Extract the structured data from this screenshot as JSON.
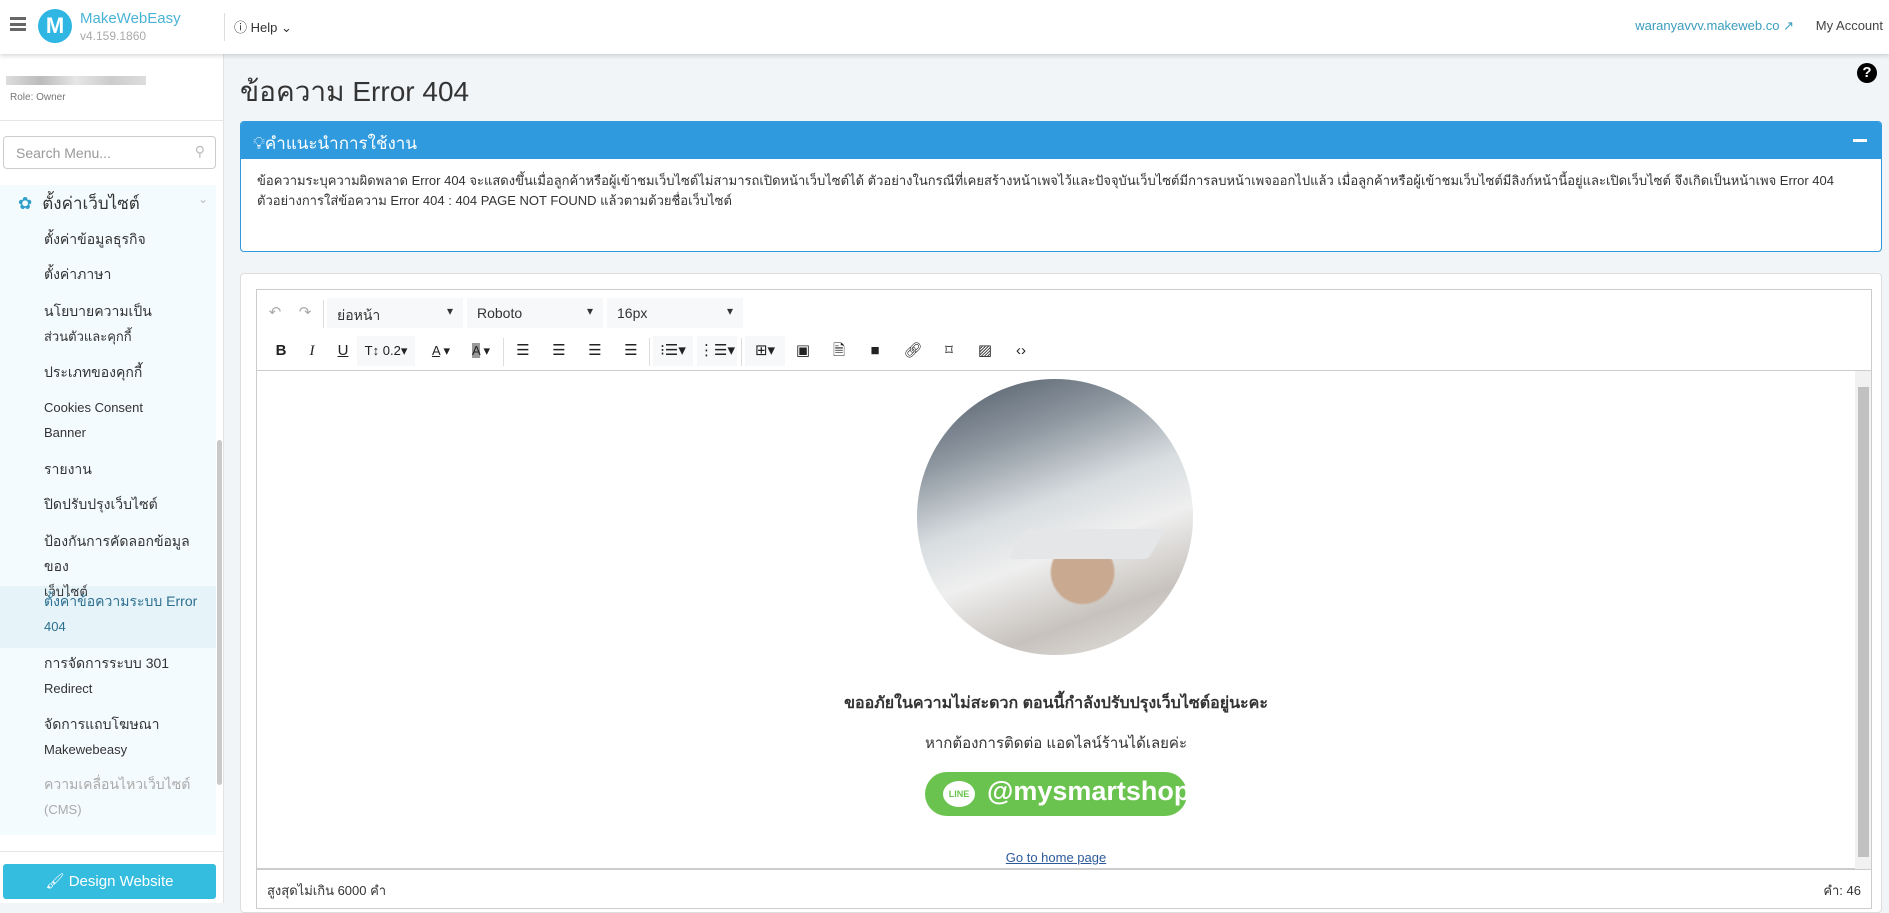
{
  "header": {
    "brand": "MakeWebEasy",
    "version": "v4.159.1860",
    "logo_letter": "M",
    "help": "Help",
    "site_link": "waranyavvv.makeweb.co",
    "account": "My Account"
  },
  "sidebar": {
    "role": "Role: Owner",
    "search_placeholder": "Search Menu...",
    "group": "ตั้งค่าเว็บไซต์",
    "items": [
      {
        "l1": "ตั้งค่าข้อมูลธุรกิจ",
        "l2": ""
      },
      {
        "l1": "ตั้งค่าภาษา",
        "l2": ""
      },
      {
        "l1": "นโยบายความเป็น",
        "l2": "ส่วนตัวและคุกกี้"
      },
      {
        "l1": "ประเภทของคุกกี้",
        "l2": ""
      },
      {
        "l1": "Cookies Consent",
        "l2": "Banner"
      },
      {
        "l1": "รายงาน",
        "l2": ""
      },
      {
        "l1": "ปิดปรับปรุงเว็บไซต์",
        "l2": ""
      },
      {
        "l1": "ป้องกันการคัดลอกข้อมูลของ",
        "l2": "เว็บไซต์"
      },
      {
        "l1": "ตั้งค่าข้อความระบบ Error",
        "l2": "404"
      },
      {
        "l1": "การจัดการระบบ 301",
        "l2": "Redirect"
      },
      {
        "l1": "จัดการแถบโฆษณา",
        "l2": "Makewebeasy"
      },
      {
        "l1": "ความเคลื่อนไหวเว็บไซต์",
        "l2": "(CMS)"
      }
    ],
    "active_index": 8,
    "design_button": "Design Website"
  },
  "main": {
    "title": "ข้อความ Error 404",
    "info": {
      "title": "คำแนะนำการใช้งาน",
      "line1": "ข้อความระบุความผิดพลาด Error 404 จะแสดงขึ้นเมื่อลูกค้าหรือผู้เข้าชมเว็บไซต์ไม่สามารถเปิดหน้าเว็บไซต์ได้ ตัวอย่างในกรณีที่เคยสร้างหน้าเพจไว้และปัจจุบันเว็บไซต์มีการลบหน้าเพจออกไปแล้ว เมื่อลูกค้าหรือผู้เข้าชมเว็บไซต์มีลิงก์หน้านี้อยู่และเปิดเว็บไซต์ จึงเกิดเป็นหน้าเพจ Error 404",
      "line2": "ตัวอย่างการใส่ข้อความ Error 404 : 404 PAGE NOT FOUND แล้วตามด้วยชื่อเว็บไซต์"
    },
    "editor": {
      "style": "ย่อหน้า",
      "font": "Roboto",
      "size": "16px",
      "line_height": "0.2",
      "content": {
        "heading": "ขออภัยในความไม่สะดวก ตอนนี้กำลังปรับปรุงเว็บไซต์อยู่นะคะ",
        "sub": "หากต้องการติดต่อ แอดไลน์ร้านได้เลยค่ะ",
        "line_badge": "LINE",
        "line_id": "@mysmartshop",
        "home_link": "Go to home page"
      },
      "footer_limit": "สูงสุดไม่เกิน 6000 คำ",
      "word_count": "คำ: 46"
    }
  },
  "colors": {
    "accent": "#2f9ade",
    "brand": "#35bde0",
    "line_green": "#6ac34e"
  }
}
